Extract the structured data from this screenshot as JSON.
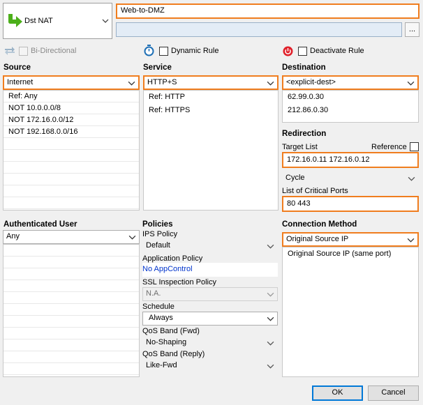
{
  "rule_type": {
    "label": "Dst NAT",
    "icon": "green-arrow-icon"
  },
  "rule_name": "Web-to-DMZ",
  "comment": "",
  "more_button": "...",
  "options": {
    "bidirectional": "Bi-Directional",
    "dynamic_rule": "Dynamic Rule",
    "deactivate_rule": "Deactivate Rule"
  },
  "source": {
    "header": "Source",
    "selected": "Internet",
    "items": [
      "Ref: Any",
      "NOT 10.0.0.0/8",
      "NOT 172.16.0.0/12",
      "NOT 192.168.0.0/16"
    ]
  },
  "service": {
    "header": "Service",
    "selected": "HTTP+S",
    "items": [
      "Ref: HTTP",
      "Ref: HTTPS"
    ]
  },
  "destination": {
    "header": "Destination",
    "selected": "<explicit-dest>",
    "items": [
      "62.99.0.30",
      "212.86.0.30"
    ]
  },
  "redirection": {
    "header": "Redirection",
    "target_list_label": "Target List",
    "reference_label": "Reference",
    "target_list_value": "172.16.0.11 172.16.0.12",
    "mode": "Cycle",
    "critical_ports_label": "List of Critical Ports",
    "critical_ports_value": "80 443"
  },
  "auth_user": {
    "header": "Authenticated User",
    "selected": "Any"
  },
  "policies": {
    "header": "Policies",
    "ips_label": "IPS Policy",
    "ips_value": "Default",
    "app_label": "Application Policy",
    "app_value": "No AppControl",
    "ssl_label": "SSL Inspection Policy",
    "ssl_value": "N.A.",
    "schedule_label": "Schedule",
    "schedule_value": "Always",
    "qos_fwd_label": "QoS Band (Fwd)",
    "qos_fwd_value": "No-Shaping",
    "qos_reply_label": "QoS Band (Reply)",
    "qos_reply_value": "Like-Fwd"
  },
  "connection": {
    "header": "Connection Method",
    "selected": "Original Source IP",
    "items": [
      "Original Source IP (same port)"
    ]
  },
  "buttons": {
    "ok": "OK",
    "cancel": "Cancel"
  },
  "colors": {
    "accent": "#f07d1e",
    "link": "#0033cc",
    "icon_green": "#4caf1a",
    "icon_red": "#e0202a",
    "icon_blue": "#1e6fb5"
  }
}
